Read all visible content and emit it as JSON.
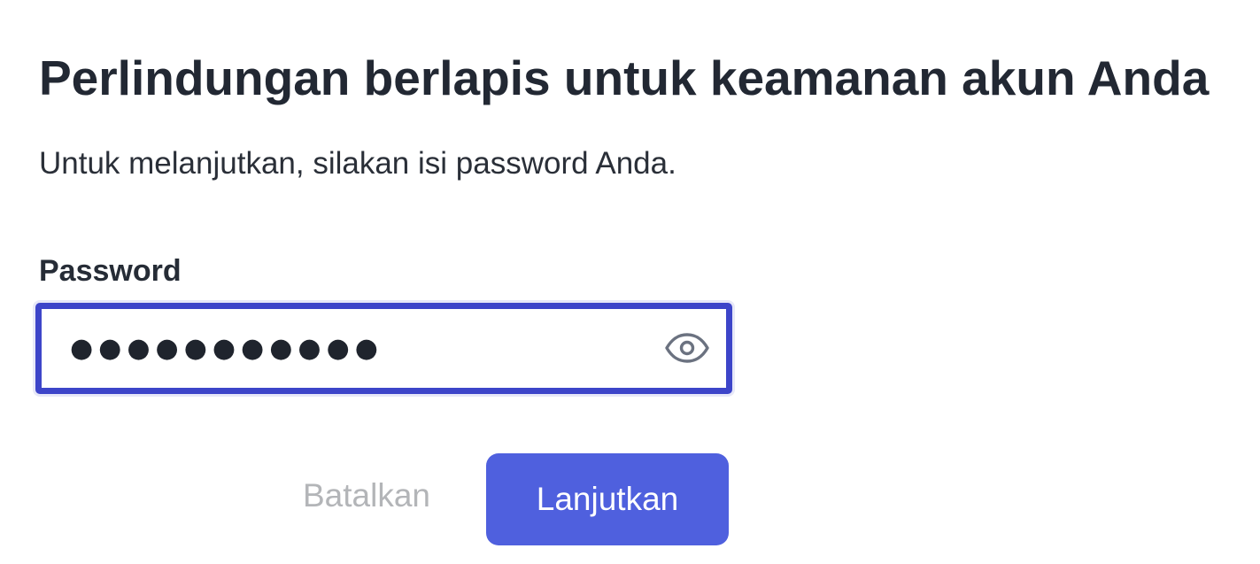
{
  "header": {
    "title": "Perlindungan berlapis untuk keamanan akun Anda",
    "subtitle": "Untuk melanjutkan, silakan isi password Anda."
  },
  "form": {
    "password_label": "Password",
    "password_value": "●●●●●●●●●●●",
    "toggle_icon": "eye-icon"
  },
  "actions": {
    "cancel_label": "Batalkan",
    "continue_label": "Lanjutkan"
  },
  "colors": {
    "focus_border": "#3d45c9",
    "primary_button": "#4f60de",
    "cancel_text": "#b3b5b8",
    "heading_text": "#222833"
  }
}
